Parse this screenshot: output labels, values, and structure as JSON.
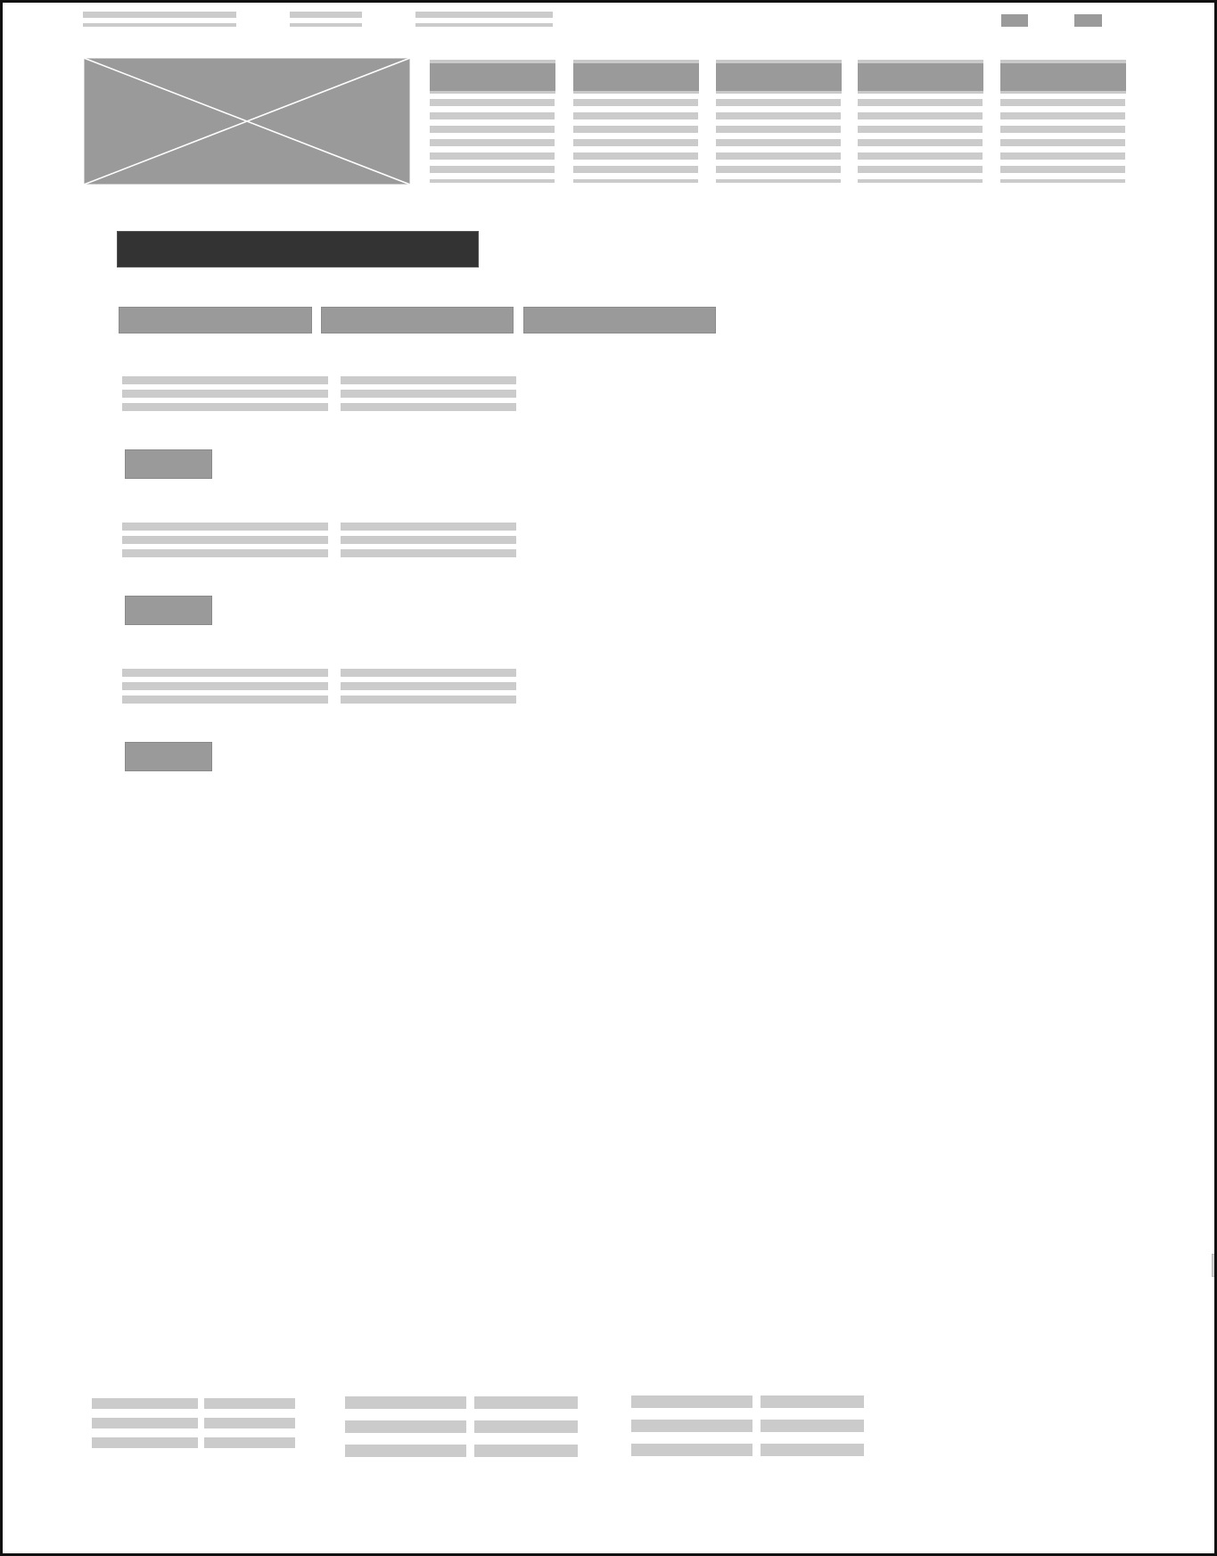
{
  "wireframe": {
    "fill_light": "#cbcbcb",
    "fill_mid": "#9a9a9a",
    "fill_dark": "#333333",
    "border": "#111111"
  },
  "top_links_count": 3,
  "top_actions_count": 2,
  "nav_columns_count": 5,
  "tabs_count": 3,
  "content_sections_count": 3,
  "footer_columns_count": 3
}
